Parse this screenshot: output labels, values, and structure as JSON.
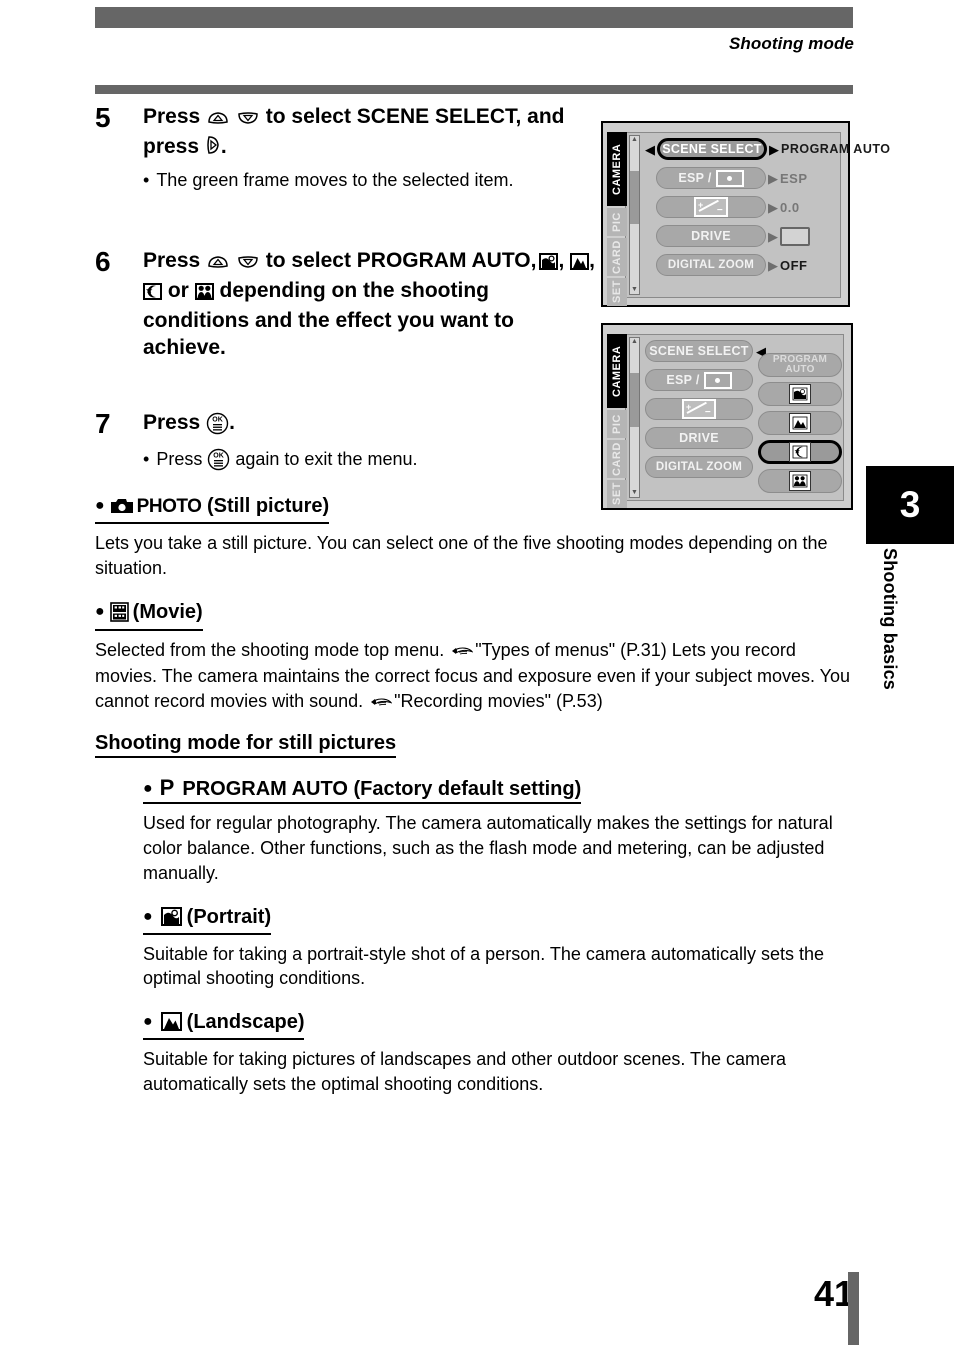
{
  "header": {
    "title": "Shooting mode"
  },
  "chapter": {
    "number": "3",
    "label": "Shooting basics"
  },
  "footer": {
    "page_number": "41"
  },
  "steps": [
    {
      "number": "5",
      "title_part1": "Press",
      "title_part2": "to select SCENE SELECT, and press",
      "title_part3": ".",
      "icons": [
        "arrow-up-button-icon",
        "arrow-down-button-icon",
        "arrow-right-button-icon"
      ],
      "bullet": "•",
      "note": "The green frame moves to the selected item."
    },
    {
      "number": "6",
      "title_part1": "Press",
      "title_part2": "to select PROGRAM AUTO,",
      "title_part3": ", ",
      "title_part4": ", ",
      "title_part5": "or",
      "title_part6": "depending on the shooting conditions and the effect you want to achieve.",
      "icons": [
        "arrow-up-button-icon",
        "arrow-down-button-icon",
        "portrait-icon",
        "landscape-icon",
        "night-scene-icon",
        "self-portrait-icon"
      ]
    },
    {
      "number": "7",
      "title_part1": "Press",
      "title_part2": ".",
      "icons": [
        "ok-menu-button-icon"
      ],
      "bullet": "•",
      "note_part1": "Press",
      "note_part2": "again to exit the menu."
    }
  ],
  "sections": [
    {
      "bullet": "●",
      "icon": "camera-icon",
      "icon_word": "PHOTO",
      "heading": "(Still picture)",
      "body": "Lets you take a still picture. You can select one of the five shooting modes depending on the situation."
    },
    {
      "bullet": "●",
      "icon": "movie-icon",
      "heading": "(Movie)",
      "body_line1_a": "Selected from the shooting mode top menu.",
      "body_line1_ref": "\"Types of menus\" (P.31)",
      "body_line2": "Lets you record movies. The camera maintains the correct focus and exposure even if your subject moves. You cannot record movies with sound.",
      "body_line3_ref": "\"Recording movies\" (P.53)",
      "pointer_icon": "pointing-hand-icon"
    }
  ],
  "subsection_heading": "Shooting mode for still pictures",
  "modes": [
    {
      "bullet": "●",
      "symbol": "P",
      "heading": "PROGRAM AUTO (Factory default setting)",
      "body": "Used for regular photography. The camera automatically makes the settings for natural color balance. Other functions, such as the flash mode and metering, can be adjusted manually."
    },
    {
      "bullet": "●",
      "icon": "portrait-icon",
      "heading": "(Portrait)",
      "body": "Suitable for taking a portrait-style shot of a person. The camera automatically sets the optimal shooting conditions."
    },
    {
      "bullet": "●",
      "icon": "landscape-icon",
      "heading": "(Landscape)",
      "body": "Suitable for taking pictures of landscapes and other outdoor scenes. The camera automatically sets the optimal shooting conditions."
    }
  ],
  "lcd_screens": [
    {
      "name": "scene-select-menu",
      "tabs": [
        {
          "label": "CAMERA",
          "selected": true
        },
        {
          "label": "PIC",
          "selected": false
        },
        {
          "label": "CARD",
          "selected": false
        },
        {
          "label": "SET",
          "selected": false
        }
      ],
      "rows": [
        {
          "label": "SCENE SELECT",
          "selected": true,
          "value": "PROGRAM AUTO",
          "value_type": "text"
        },
        {
          "label": "ESP /",
          "selected": false,
          "value": "ESP",
          "value_type": "text"
        },
        {
          "label": "",
          "selected": false,
          "value": "0.0",
          "value_type": "text"
        },
        {
          "label": "DRIVE",
          "selected": false,
          "value": "",
          "value_type": "box"
        },
        {
          "label": "DIGITAL ZOOM",
          "selected": false,
          "value": "OFF",
          "value_type": "text"
        }
      ]
    },
    {
      "name": "scene-select-options",
      "tabs": [
        {
          "label": "CAMERA",
          "selected": true
        },
        {
          "label": "PIC",
          "selected": false
        },
        {
          "label": "CARD",
          "selected": false
        },
        {
          "label": "SET",
          "selected": false
        }
      ],
      "rows": [
        {
          "label": "SCENE SELECT",
          "selected": false
        },
        {
          "label": "ESP /",
          "selected": false
        },
        {
          "label": "",
          "selected": false
        },
        {
          "label": "DRIVE",
          "selected": false
        },
        {
          "label": "DIGITAL ZOOM",
          "selected": false
        }
      ],
      "options": [
        {
          "label": "PROGRAM AUTO",
          "icon": "",
          "selected": false
        },
        {
          "label": "",
          "icon": "portrait-icon",
          "selected": false
        },
        {
          "label": "",
          "icon": "landscape-icon",
          "selected": false
        },
        {
          "label": "",
          "icon": "night-scene-icon",
          "selected": true
        },
        {
          "label": "",
          "icon": "self-portrait-icon",
          "selected": false
        }
      ]
    }
  ],
  "colors": {
    "bar_gray": "#666666",
    "lcd_bg": "#c2c2c2",
    "lcd_frame": "#cfcfcf",
    "pill_gray": "#a8a8a8",
    "selected_black": "#000000"
  }
}
